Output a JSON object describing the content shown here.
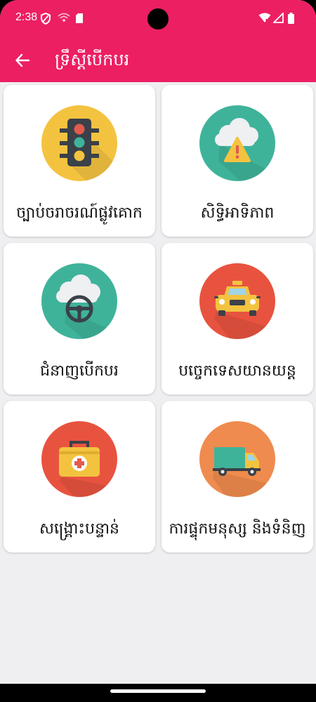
{
  "status_bar": {
    "time": "2:38",
    "icons": [
      "shield-icon",
      "wifi-calling-icon",
      "sd-card-icon",
      "wifi-icon",
      "signal-icon",
      "battery-icon"
    ]
  },
  "app_bar": {
    "title": "ទ្រឹស្ដីបើកបរ",
    "back_icon": "arrow-left-icon",
    "color": "#ec1f63"
  },
  "categories": [
    {
      "label": "ច្បាប់ចរាចរណ៍ផ្លូវគោក",
      "icon": "traffic-light-icon",
      "circle_color": "#f3c340"
    },
    {
      "label": "សិទ្ធិអាទិភាព",
      "icon": "cloud-warning-icon",
      "circle_color": "#3fb39a"
    },
    {
      "label": "ជំនាញបើកបរ",
      "icon": "steering-wheel-icon",
      "circle_color": "#3fb39a"
    },
    {
      "label": "បច្ចេកទេសយានយន្ត",
      "icon": "taxi-car-icon",
      "circle_color": "#e8533f"
    },
    {
      "label": "សង្គ្រោះបន្ទាន់",
      "icon": "first-aid-kit-icon",
      "circle_color": "#e8533f"
    },
    {
      "label": "ការផ្ទុកមនុស្ស និងទំនិញ",
      "icon": "truck-icon",
      "circle_color": "#ef8b4e"
    }
  ]
}
